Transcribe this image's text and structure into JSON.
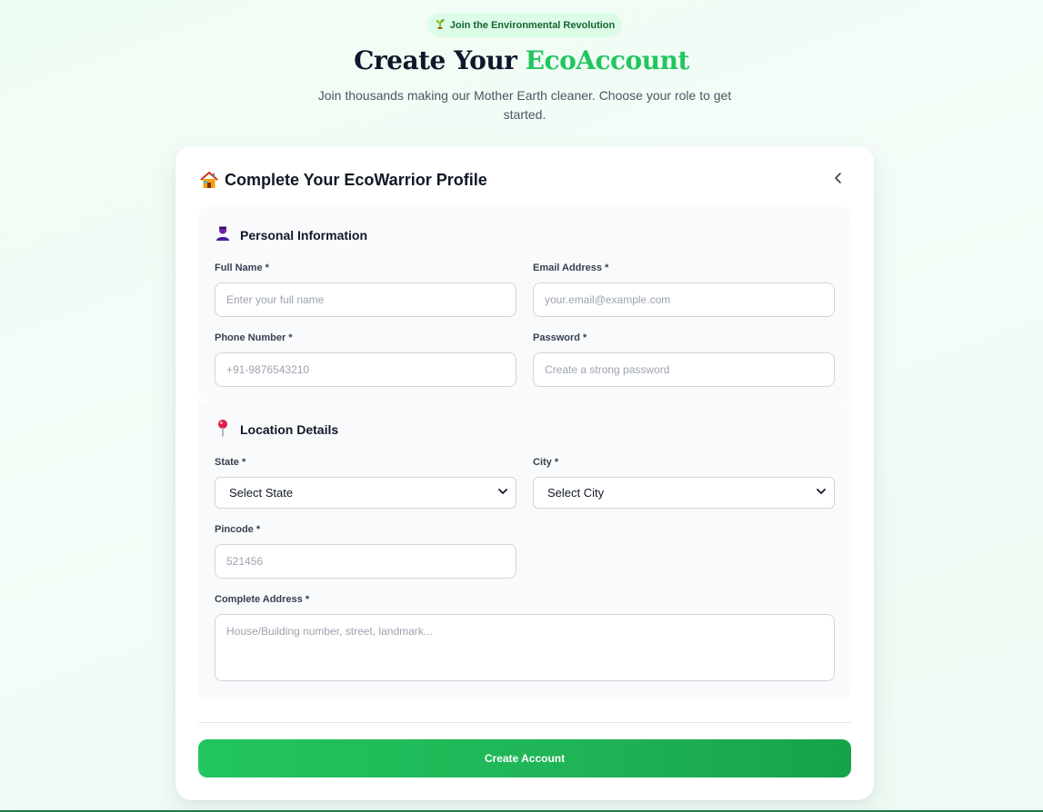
{
  "badge": {
    "text": "Join the Environmental Revolution",
    "icon": "sprout-icon"
  },
  "header": {
    "title_prefix": "Create Your ",
    "title_accent": "EcoAccount",
    "subtitle": "Join thousands making our Mother Earth cleaner. Choose your role to get started."
  },
  "card": {
    "title": "Complete Your EcoWarrior Profile",
    "icon": "house-icon",
    "back_icon": "chevron-left-icon"
  },
  "personal": {
    "title": "Personal Information",
    "icon": "person-icon",
    "full_name": {
      "label": "Full Name *",
      "placeholder": "Enter your full name"
    },
    "email": {
      "label": "Email Address *",
      "placeholder": "your.email@example.com"
    },
    "phone": {
      "label": "Phone Number *",
      "placeholder": "+91-9876543210"
    },
    "password": {
      "label": "Password *",
      "placeholder": "Create a strong password"
    }
  },
  "location": {
    "title": "Location Details",
    "icon": "pushpin-icon",
    "state": {
      "label": "State *",
      "value": "Select State"
    },
    "city": {
      "label": "City *",
      "value": "Select City"
    },
    "pincode": {
      "label": "Pincode *",
      "placeholder": "521456"
    },
    "address": {
      "label": "Complete Address *",
      "placeholder": "House/Building number, street, landmark..."
    }
  },
  "submit_label": "Create Account",
  "colors": {
    "accent": "#22c55e",
    "accent_dark": "#16a34a",
    "badge_bg": "#dcfce7",
    "badge_text": "#166534"
  }
}
